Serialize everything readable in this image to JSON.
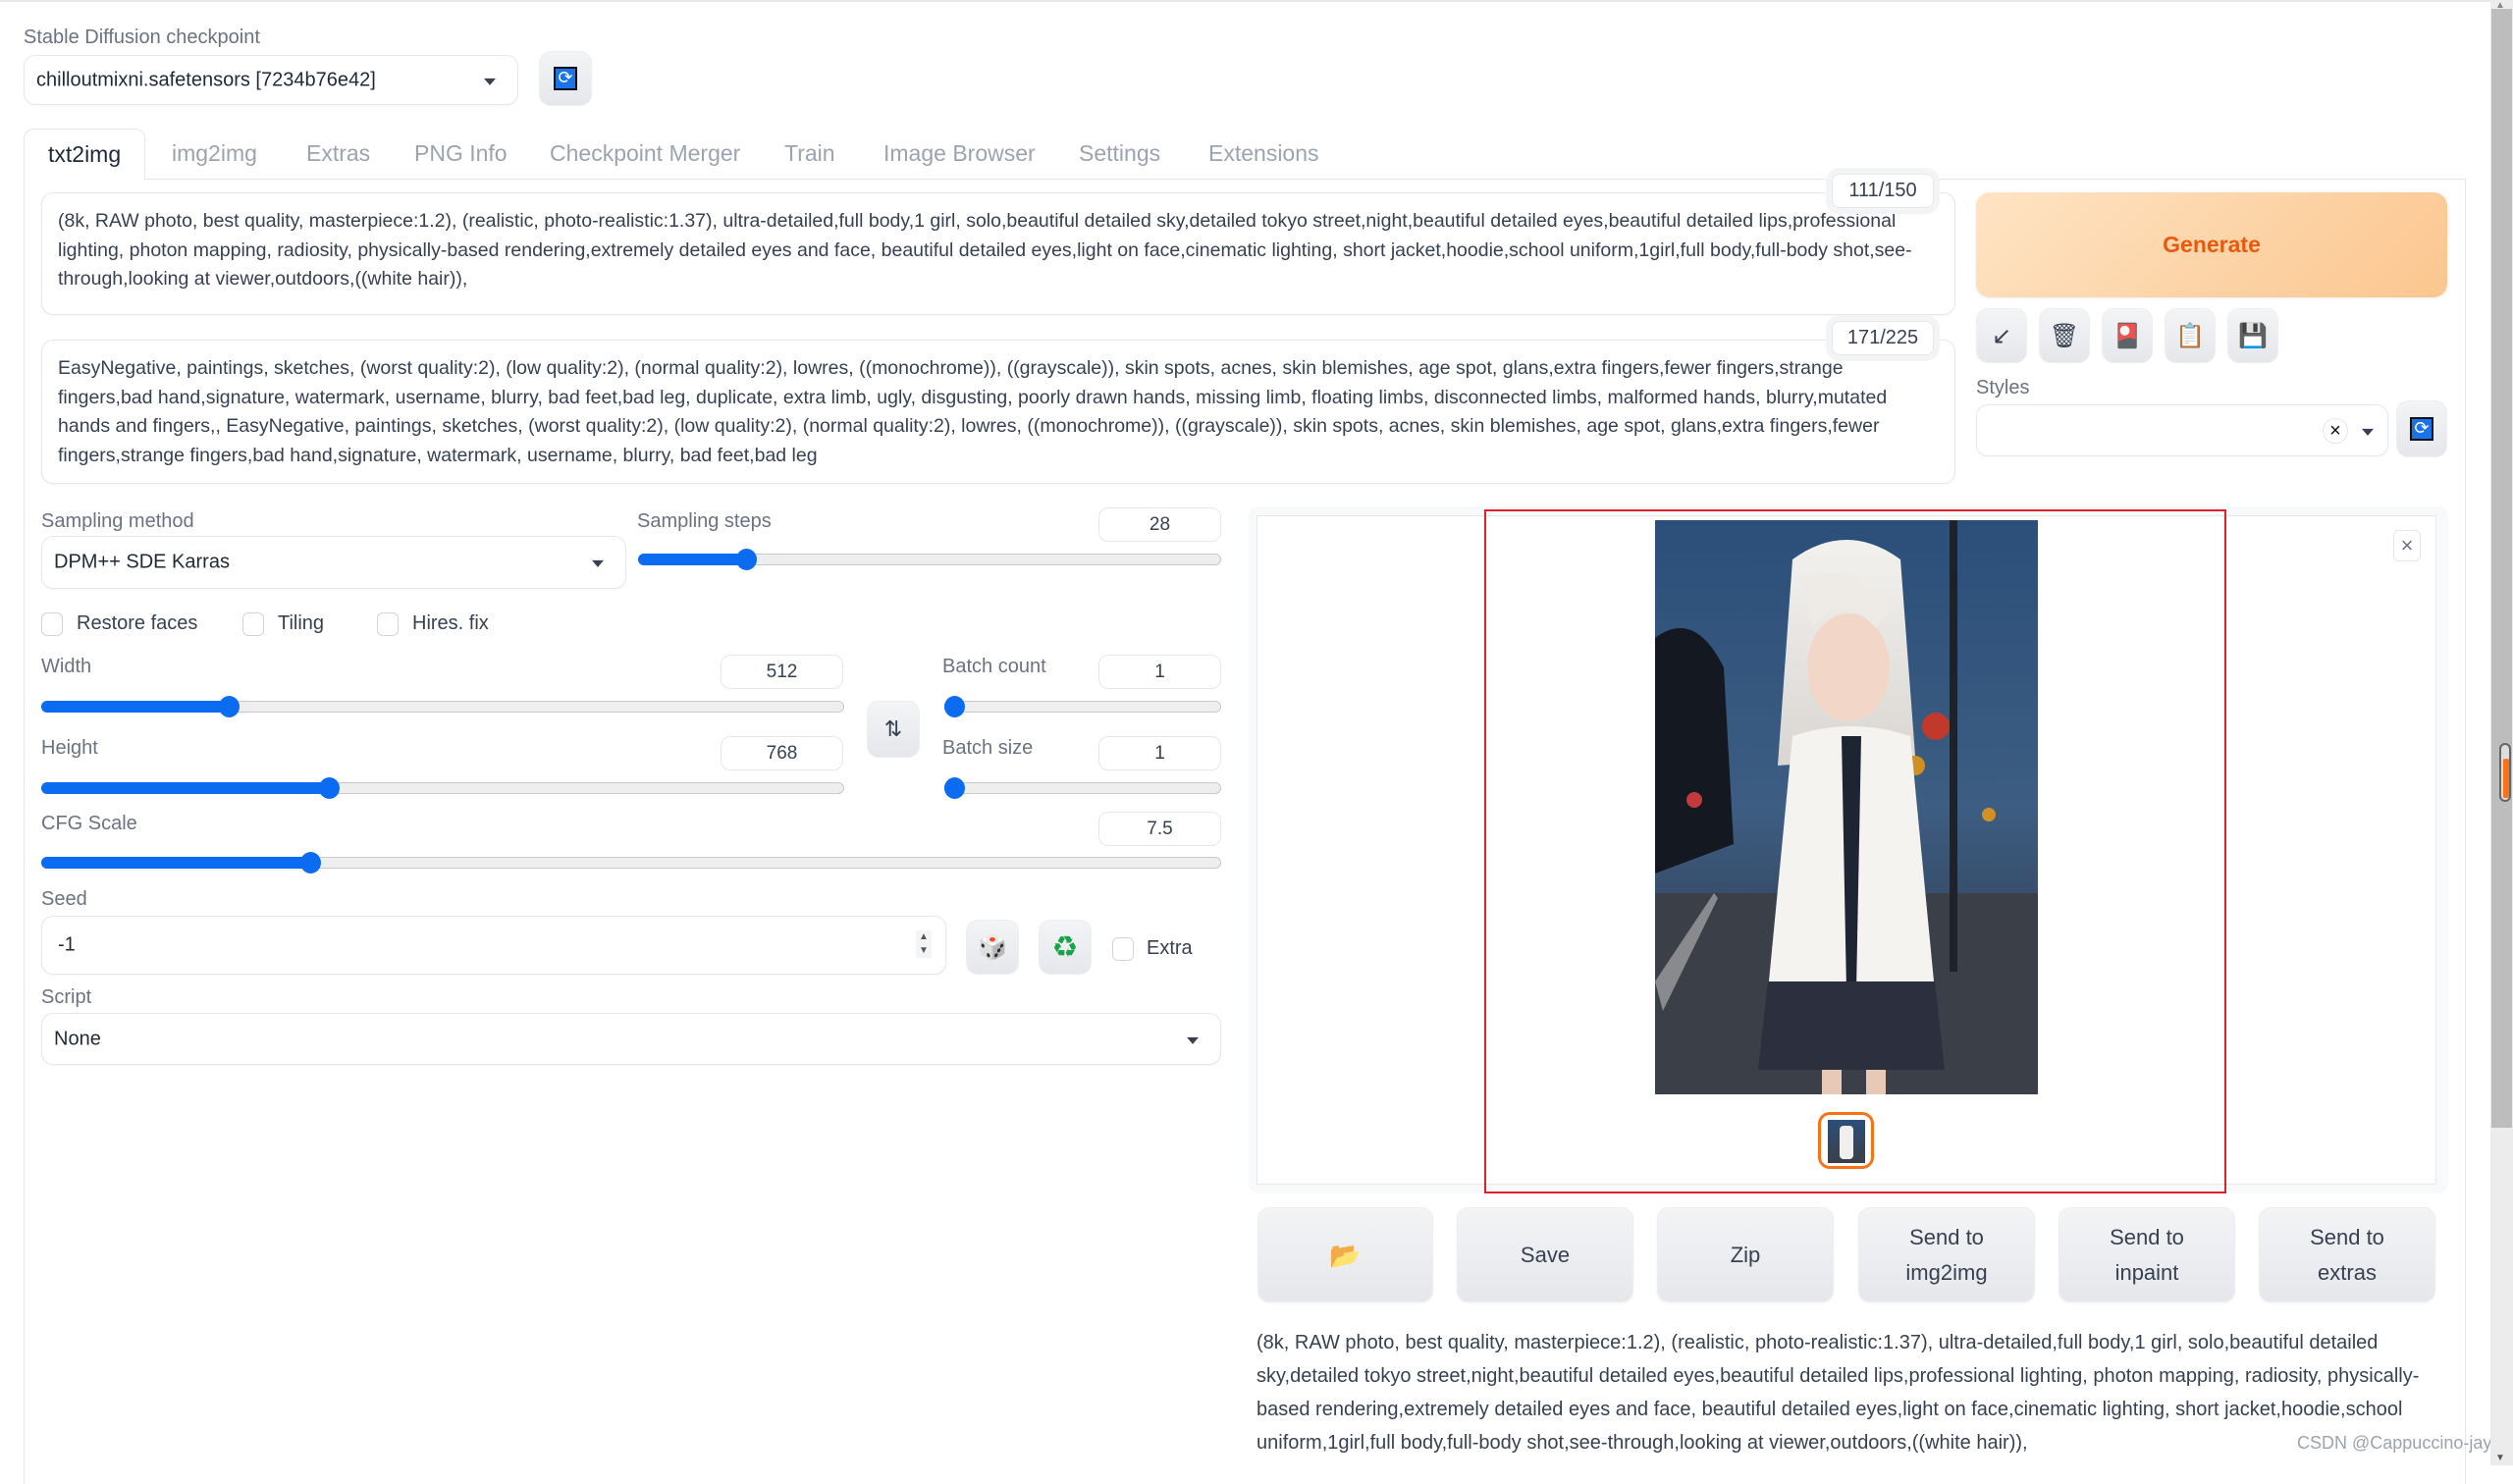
{
  "checkpoint": {
    "label": "Stable Diffusion checkpoint",
    "value": "chilloutmixni.safetensors [7234b76e42]",
    "refresh_icon": "refresh-icon"
  },
  "tabs": [
    {
      "label": "txt2img",
      "active": true
    },
    {
      "label": "img2img"
    },
    {
      "label": "Extras"
    },
    {
      "label": "PNG Info"
    },
    {
      "label": "Checkpoint Merger"
    },
    {
      "label": "Train"
    },
    {
      "label": "Image Browser"
    },
    {
      "label": "Settings"
    },
    {
      "label": "Extensions"
    }
  ],
  "prompt": {
    "text": "(8k, RAW photo, best quality, masterpiece:1.2), (realistic, photo-realistic:1.37), ultra-detailed,full body,1 girl, solo,beautiful detailed sky,detailed tokyo street,night,beautiful detailed eyes,beautiful detailed lips,professional lighting, photon mapping, radiosity, physically-based rendering,extremely detailed eyes and face, beautiful detailed eyes,light on face,cinematic lighting, short jacket,hoodie,school uniform,1girl,full body,full-body shot,see-through,looking at viewer,outdoors,((white hair)),",
    "token_count": "111/150"
  },
  "negative_prompt": {
    "text": "EasyNegative, paintings, sketches, (worst quality:2), (low quality:2), (normal quality:2), lowres, ((monochrome)), ((grayscale)), skin spots, acnes, skin blemishes, age spot, glans,extra fingers,fewer fingers,strange fingers,bad hand,signature, watermark, username, blurry, bad feet,bad leg, duplicate, extra limb, ugly, disgusting, poorly drawn hands, missing limb, floating limbs, disconnected limbs, malformed hands, blurry,mutated hands and fingers,, EasyNegative, paintings, sketches, (worst quality:2), (low quality:2), (normal quality:2), lowres, ((monochrome)), ((grayscale)), skin spots, acnes, skin blemishes, age spot, glans,extra fingers,fewer fingers,strange fingers,bad hand,signature, watermark, username, blurry, bad feet,bad leg",
    "token_count": "171/225"
  },
  "actions": {
    "generate_label": "Generate",
    "tool_icons": [
      "arrow-down-left-icon",
      "trash-icon",
      "picture-card-icon",
      "clipboard-icon",
      "floppy-disk-icon"
    ],
    "tool_glyphs": [
      "↙",
      "🗑",
      "🎴",
      "📋",
      "💾"
    ],
    "styles_label": "Styles",
    "styles_value": "",
    "styles_clear": "×"
  },
  "sampling": {
    "method_label": "Sampling method",
    "method_value": "DPM++ SDE Karras",
    "steps_label": "Sampling steps",
    "steps_value": "28",
    "steps_fraction": 0.186
  },
  "checkboxes": [
    {
      "label": "Restore faces",
      "checked": false
    },
    {
      "label": "Tiling",
      "checked": false
    },
    {
      "label": "Hires. fix",
      "checked": false
    }
  ],
  "size": {
    "width_label": "Width",
    "width_value": "512",
    "width_fraction": 0.234,
    "height_label": "Height",
    "height_value": "768",
    "height_fraction": 0.358,
    "swap_glyph": "⇅"
  },
  "batch": {
    "count_label": "Batch count",
    "count_value": "1",
    "count_fraction": 0.0,
    "size_label": "Batch size",
    "size_value": "1",
    "size_fraction": 0.0
  },
  "cfg": {
    "label": "CFG Scale",
    "value": "7.5",
    "fraction": 0.228
  },
  "seed": {
    "label": "Seed",
    "value": "-1",
    "dice_glyph": "🎲",
    "recycle_glyph": "♻",
    "extra_label": "Extra",
    "extra_checked": false
  },
  "script": {
    "label": "Script",
    "value": "None"
  },
  "output": {
    "close_glyph": "×",
    "folder_glyph": "📂",
    "buttons": [
      {
        "label": ""
      },
      {
        "label": "Save"
      },
      {
        "label": "Zip"
      },
      {
        "label": "Send to img2img"
      },
      {
        "label": "Send to inpaint"
      },
      {
        "label": "Send to extras"
      }
    ],
    "generation_info": "(8k, RAW photo, best quality, masterpiece:1.2), (realistic, photo-realistic:1.37), ultra-detailed,full body,1 girl, solo,beautiful detailed sky,detailed tokyo street,night,beautiful detailed eyes,beautiful detailed lips,professional lighting, photon mapping, radiosity, physically-based rendering,extremely detailed eyes and face, beautiful detailed eyes,light on face,cinematic lighting, short jacket,hoodie,school uniform,1girl,full body,full-body shot,see-through,looking at viewer,outdoors,((white hair)),",
    "image_description": "Generated photo of a white-haired girl in a white hoodie on a night street"
  },
  "watermark": "CSDN @Cappuccino-jay",
  "colors": {
    "accent": "#0b6cf2",
    "generate_text": "#ea580c",
    "highlight_box": "#e0202a",
    "thumb_border": "#f97316"
  }
}
